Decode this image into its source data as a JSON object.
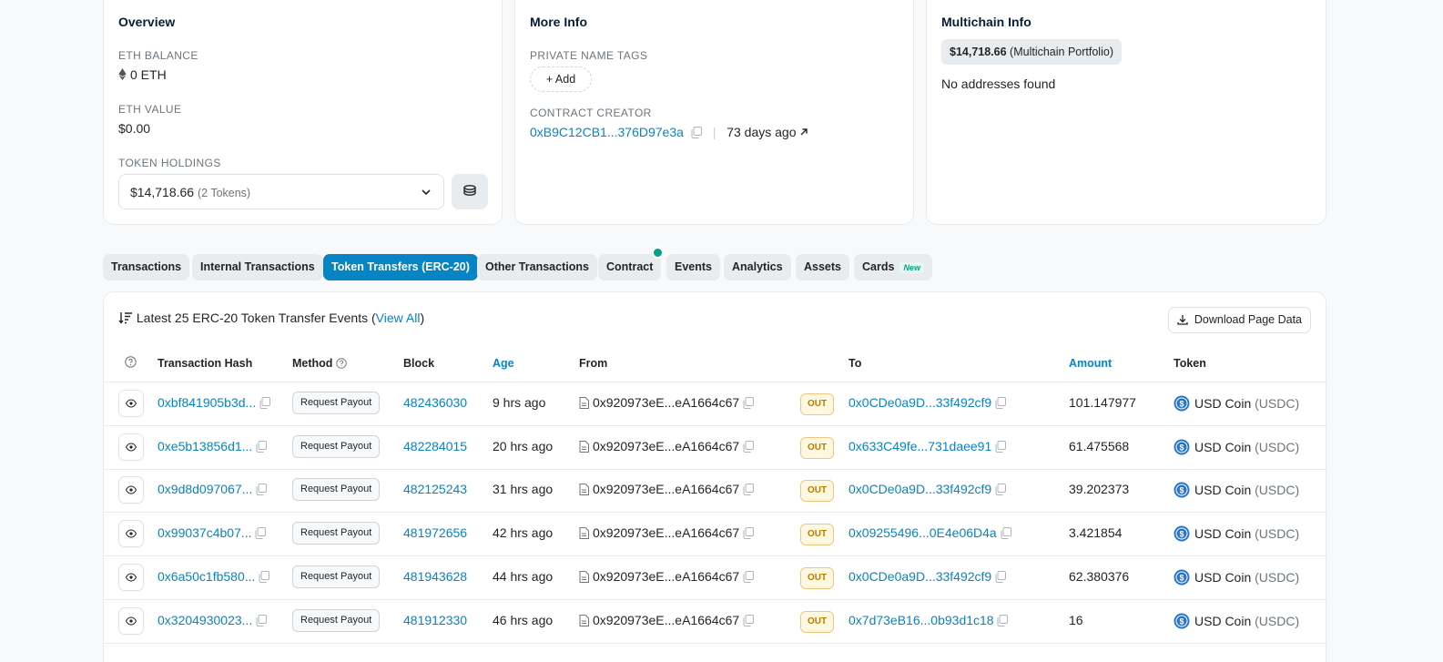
{
  "overview": {
    "title": "Overview",
    "eth_balance_label": "ETH BALANCE",
    "eth_balance": "0 ETH",
    "eth_value_label": "ETH VALUE",
    "eth_value": "$0.00",
    "token_holdings_label": "TOKEN HOLDINGS",
    "token_holdings_value": "$14,718.66",
    "token_holdings_count": "(2 Tokens)"
  },
  "more_info": {
    "title": "More Info",
    "private_tags_label": "PRIVATE NAME TAGS",
    "add_label": "Add",
    "contract_creator_label": "CONTRACT CREATOR",
    "creator_address": "0xB9C12CB1...376D97e3a",
    "creator_age": "73 days ago"
  },
  "multichain": {
    "title": "Multichain Info",
    "portfolio_value": "$14,718.66",
    "portfolio_suffix": "(Multichain Portfolio)",
    "no_addresses": "No addresses found"
  },
  "tabs": [
    {
      "label": "Transactions"
    },
    {
      "label": "Internal Transactions"
    },
    {
      "label": "Token Transfers (ERC-20)"
    },
    {
      "label": "Other Transactions"
    },
    {
      "label": "Contract"
    },
    {
      "label": "Events"
    },
    {
      "label": "Analytics"
    },
    {
      "label": "Assets"
    },
    {
      "label": "Cards",
      "badge": "New"
    }
  ],
  "table": {
    "heading_prefix": "Latest 25 ERC-20 Token Transfer Events (",
    "view_all": "View All",
    "heading_suffix": ")",
    "download_label": "Download Page Data",
    "columns": {
      "hash": "Transaction Hash",
      "method": "Method",
      "block": "Block",
      "age": "Age",
      "from": "From",
      "to": "To",
      "amount": "Amount",
      "token": "Token"
    },
    "rows": [
      {
        "hash": "0xbf841905b3d...",
        "method": "Request Payout",
        "block": "482436030",
        "age": "9 hrs ago",
        "from": "0x920973eE...eA1664c67",
        "dir": "OUT",
        "to": "0x0CDe0a9D...33f492cf9",
        "amount": "101.147977",
        "token": "USD Coin",
        "symbol": "(USDC)"
      },
      {
        "hash": "0xe5b13856d1...",
        "method": "Request Payout",
        "block": "482284015",
        "age": "20 hrs ago",
        "from": "0x920973eE...eA1664c67",
        "dir": "OUT",
        "to": "0x633C49fe...731daee91",
        "amount": "61.475568",
        "token": "USD Coin",
        "symbol": "(USDC)"
      },
      {
        "hash": "0x9d8d097067...",
        "method": "Request Payout",
        "block": "482125243",
        "age": "31 hrs ago",
        "from": "0x920973eE...eA1664c67",
        "dir": "OUT",
        "to": "0x0CDe0a9D...33f492cf9",
        "amount": "39.202373",
        "token": "USD Coin",
        "symbol": "(USDC)"
      },
      {
        "hash": "0x99037c4b07...",
        "method": "Request Payout",
        "block": "481972656",
        "age": "42 hrs ago",
        "from": "0x920973eE...eA1664c67",
        "dir": "OUT",
        "to": "0x09255496...0E4e06D4a",
        "amount": "3.421854",
        "token": "USD Coin",
        "symbol": "(USDC)"
      },
      {
        "hash": "0x6a50c1fb580...",
        "method": "Request Payout",
        "block": "481943628",
        "age": "44 hrs ago",
        "from": "0x920973eE...eA1664c67",
        "dir": "OUT",
        "to": "0x0CDe0a9D...33f492cf9",
        "amount": "62.380376",
        "token": "USD Coin",
        "symbol": "(USDC)"
      },
      {
        "hash": "0x3204930023...",
        "method": "Request Payout",
        "block": "481912330",
        "age": "46 hrs ago",
        "from": "0x920973eE...eA1664c67",
        "dir": "OUT",
        "to": "0x7d73eB16...0b93d1c18",
        "amount": "16",
        "token": "USD Coin",
        "symbol": "(USDC)"
      }
    ]
  }
}
